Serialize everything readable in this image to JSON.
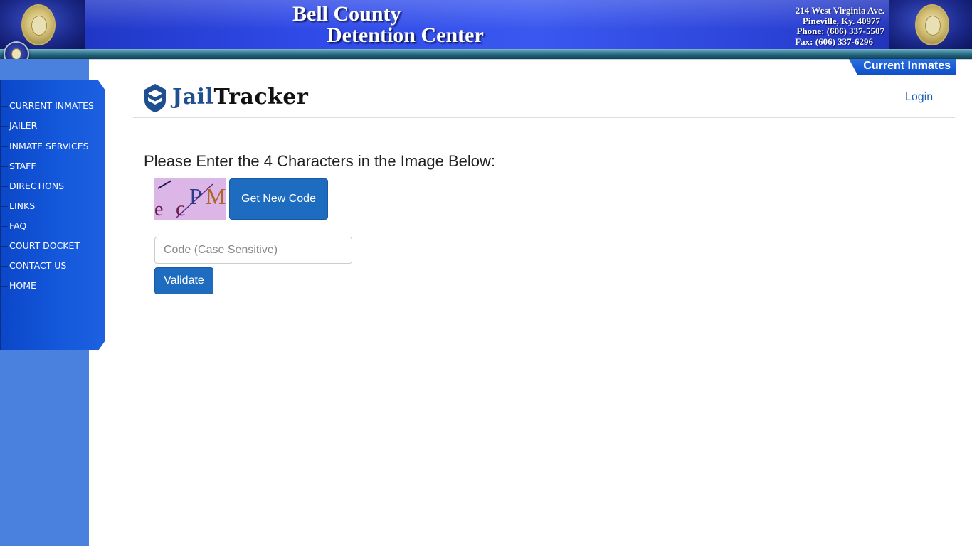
{
  "banner": {
    "title_line1": "Bell County",
    "title_line2": "Detention Center",
    "address": {
      "street": "214 West Virginia Ave.",
      "city": "Pineville, Ky. 40977",
      "phone": "Phone: (606) 337-5507",
      "fax": "Fax: (606) 337-6296"
    }
  },
  "nav": {
    "items": [
      {
        "label": "CURRENT INMATES"
      },
      {
        "label": "JAILER"
      },
      {
        "label": "INMATE SERVICES"
      },
      {
        "label": "STAFF"
      },
      {
        "label": "DIRECTIONS"
      },
      {
        "label": "LINKS"
      },
      {
        "label": "FAQ"
      },
      {
        "label": "COURT DOCKET"
      },
      {
        "label": "CONTACT US"
      },
      {
        "label": "HOME"
      }
    ]
  },
  "tab": {
    "current_inmates": "Current Inmates"
  },
  "jailtracker": {
    "brand_part1": "Jail",
    "brand_part2": "Tracker",
    "login_label": "Login"
  },
  "captcha": {
    "prompt": "Please Enter the 4 Characters in the Image Below:",
    "image_chars": [
      "e",
      "c",
      "P",
      "M"
    ],
    "new_code_label": "Get New Code",
    "input_placeholder": "Code (Case Sensitive)",
    "input_value": "",
    "validate_label": "Validate"
  },
  "colors": {
    "banner_blue": "#2f49e6",
    "nav_blue": "#1559dc",
    "left_column": "#4a80de",
    "button_blue": "#1e6cc0",
    "link_blue": "#1f5fb8",
    "captcha_bg": "#dcb6e6"
  },
  "icons": {
    "state_seal": "kentucky-seal-icon",
    "jailtracker_logo": "shield-logo-icon"
  }
}
